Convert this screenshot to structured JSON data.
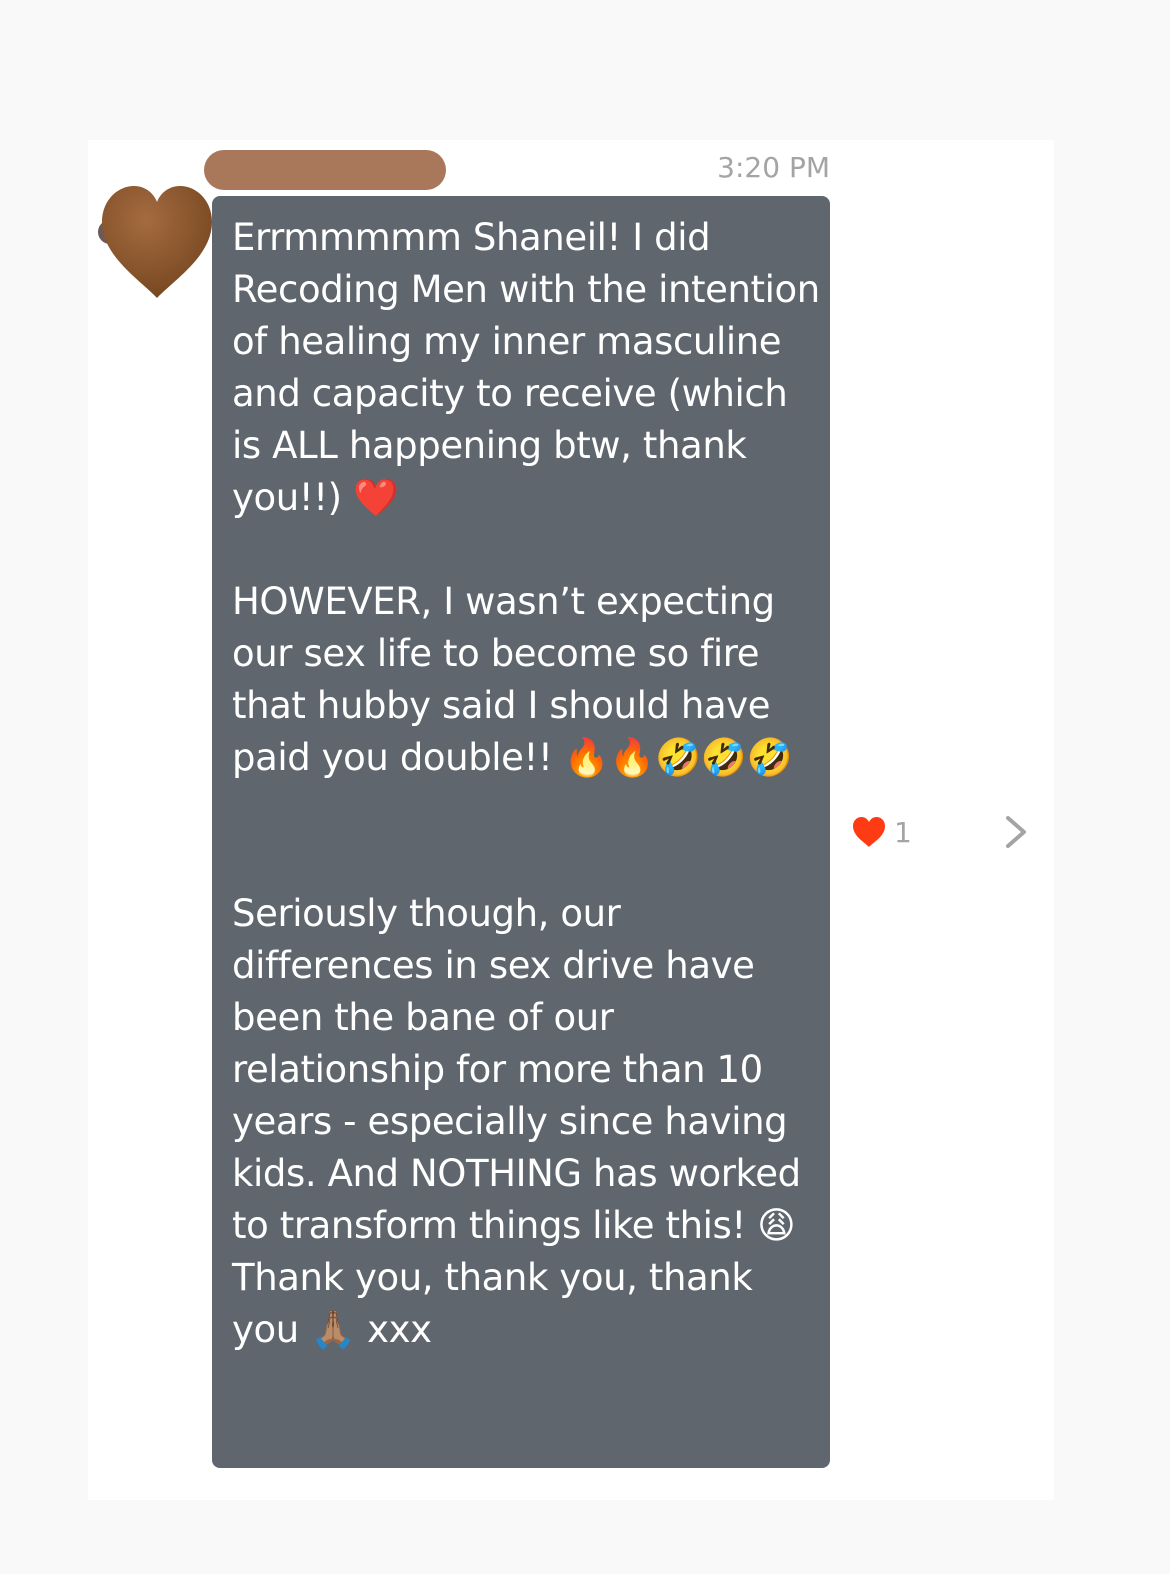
{
  "message": {
    "sender_name_redacted": "",
    "timestamp": "3:20 PM",
    "avatar_icon": "brown-heart-icon",
    "text": "Errmmmmm Shaneil! I did Recoding Men with the intention of healing my inner masculine and capacity to receive (which is ALL happening btw, thank you!!) ❤️\n\nHOWEVER, I wasn’t expecting our sex life to become so fire that hubby said I should have paid you double!! 🔥🔥🤣🤣🤣\n\n\nSeriously though, our differences in sex drive have been the bane of our relationship for more than 10 years - especially since having kids. And NOTHING has worked to transform things like this! 😩\nThank you, thank you, thank you 🙏🏽 xxx"
  },
  "reaction": {
    "icon": "heart-icon",
    "count": "1"
  },
  "navigation": {
    "icon": "chevron-right-icon"
  },
  "colors": {
    "bubble": "#5f666d",
    "avatar_heart": "#8a5630",
    "redaction": "#a9775a",
    "reaction_heart": "#ff3b14",
    "muted_text": "#a4a4a6"
  }
}
